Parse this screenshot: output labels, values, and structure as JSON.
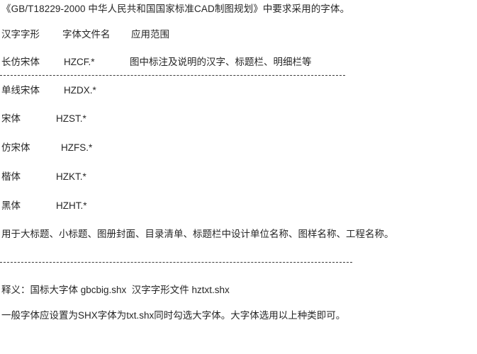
{
  "document": {
    "title": "《GB/T18229-2000 中华人民共和国国家标准CAD制图规划》中要求采用的字体。",
    "table_header": {
      "col1": "汉字字形",
      "col2": "字体文件名",
      "col3": "应用范围"
    },
    "rows": [
      {
        "glyph_style": "长仿宋体",
        "font_file": "HZCF.*",
        "usage": "图中标注及说明的汉字、标题栏、明细栏等"
      },
      {
        "glyph_style": "单线宋体",
        "font_file": "HZDX.*",
        "usage": ""
      },
      {
        "glyph_style": "宋体",
        "font_file": "HZST.*",
        "usage": ""
      },
      {
        "glyph_style": "仿宋体",
        "font_file": "HZFS.*",
        "usage": ""
      },
      {
        "glyph_style": "楷体",
        "font_file": "HZKT.*",
        "usage": ""
      },
      {
        "glyph_style": "黑体",
        "font_file": "HZHT.*",
        "usage": ""
      }
    ],
    "usage_note": "用于大标题、小标题、图册封面、目录清单、标题栏中设计单位名称、图样名称、工程名称。",
    "definition_line": "释义：国标大字体 gbcbig.shx  汉字字形文件 hztxt.shx",
    "closing_note": "一般字体应设置为SHX字体为txt.shx同时勾选大字体。大字体选用以上种类即可。",
    "text_color": "#262626",
    "background_color": "#ffffff",
    "rule_color": "#3a3a3a"
  }
}
